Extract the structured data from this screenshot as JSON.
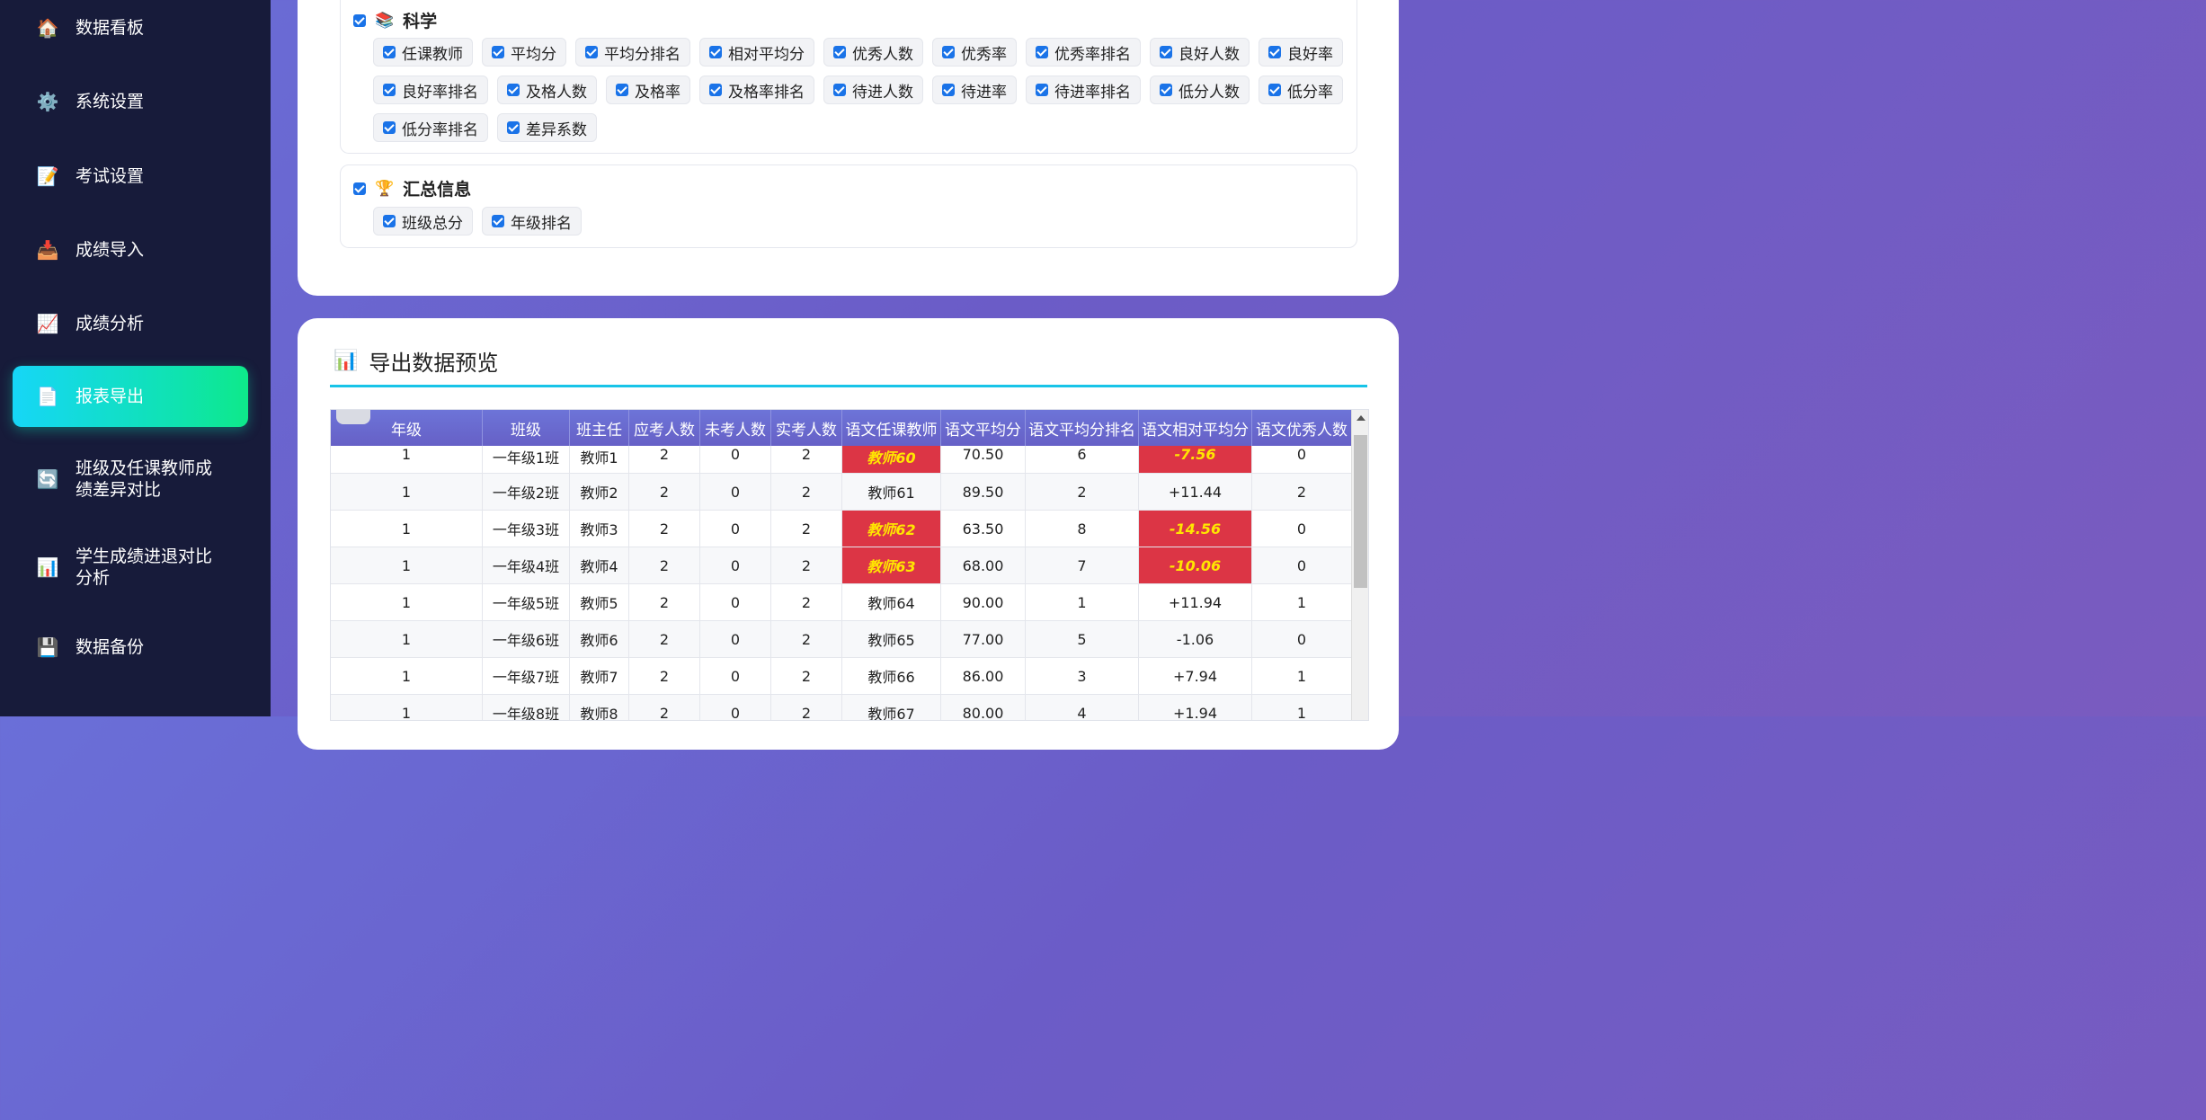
{
  "sidebar": {
    "items": [
      {
        "label": "数据看板",
        "icon": "🏠"
      },
      {
        "label": "系统设置",
        "icon": "⚙️"
      },
      {
        "label": "考试设置",
        "icon": "📝"
      },
      {
        "label": "成绩导入",
        "icon": "📥"
      },
      {
        "label": "成绩分析",
        "icon": "📈"
      },
      {
        "label": "报表导出",
        "icon": "📄"
      },
      {
        "label": "班级及任课教师成绩差异对比",
        "icon": "🔄"
      },
      {
        "label": "学生成绩进退对比分析",
        "icon": "📊"
      },
      {
        "label": "数据备份",
        "icon": "💾"
      }
    ],
    "active_index": 5
  },
  "groups": {
    "science": {
      "title": "科学",
      "icon": "📚",
      "fields": [
        "任课教师",
        "平均分",
        "平均分排名",
        "相对平均分",
        "优秀人数",
        "优秀率",
        "优秀率排名",
        "良好人数",
        "良好率",
        "良好率排名",
        "及格人数",
        "及格率",
        "及格率排名",
        "待进人数",
        "待进率",
        "待进率排名",
        "低分人数",
        "低分率",
        "低分率排名",
        "差异系数"
      ]
    },
    "summary": {
      "title": "汇总信息",
      "icon": "🏆",
      "fields": [
        "班级总分",
        "年级排名"
      ]
    }
  },
  "preview": {
    "title": "导出数据预览",
    "icon": "📊",
    "columns": [
      "年级",
      "班级",
      "班主任",
      "应考人数",
      "未考人数",
      "实考人数",
      "语文任课教师",
      "语文平均分",
      "语文平均分排名",
      "语文相对平均分",
      "语文优秀人数"
    ],
    "rows": [
      [
        "1",
        "一年级1班",
        "教师1",
        "2",
        "0",
        "2",
        "教师60",
        "70.50",
        "6",
        "-7.56",
        "0"
      ],
      [
        "1",
        "一年级2班",
        "教师2",
        "2",
        "0",
        "2",
        "教师61",
        "89.50",
        "2",
        "+11.44",
        "2"
      ],
      [
        "1",
        "一年级3班",
        "教师3",
        "2",
        "0",
        "2",
        "教师62",
        "63.50",
        "8",
        "-14.56",
        "0"
      ],
      [
        "1",
        "一年级4班",
        "教师4",
        "2",
        "0",
        "2",
        "教师63",
        "68.00",
        "7",
        "-10.06",
        "0"
      ],
      [
        "1",
        "一年级5班",
        "教师5",
        "2",
        "0",
        "2",
        "教师64",
        "90.00",
        "1",
        "+11.94",
        "1"
      ],
      [
        "1",
        "一年级6班",
        "教师6",
        "2",
        "0",
        "2",
        "教师65",
        "77.00",
        "5",
        "-1.06",
        "0"
      ],
      [
        "1",
        "一年级7班",
        "教师7",
        "2",
        "0",
        "2",
        "教师66",
        "86.00",
        "3",
        "+7.94",
        "1"
      ],
      [
        "1",
        "一年级8班",
        "教师8",
        "2",
        "0",
        "2",
        "教师67",
        "80.00",
        "4",
        "+1.94",
        "1"
      ]
    ],
    "highlight_rows": [
      0,
      2,
      3
    ],
    "highlight_cols": [
      6,
      9
    ]
  }
}
